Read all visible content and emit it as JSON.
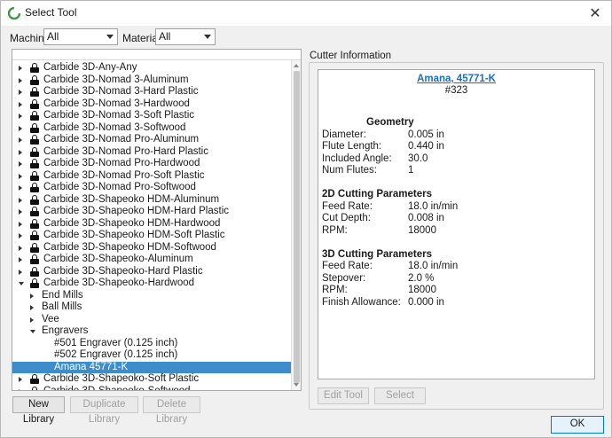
{
  "window": {
    "title": "Select Tool"
  },
  "filters": {
    "machine_label": "Machine",
    "machine_value": "All",
    "material_label": "Material",
    "material_value": "All"
  },
  "tree": [
    {
      "label": "Carbide 3D-Any-Any",
      "level": 0,
      "expander": "collapsed",
      "lock": true
    },
    {
      "label": "Carbide 3D-Nomad 3-Aluminum",
      "level": 0,
      "expander": "collapsed",
      "lock": true
    },
    {
      "label": "Carbide 3D-Nomad 3-Hard Plastic",
      "level": 0,
      "expander": "collapsed",
      "lock": true
    },
    {
      "label": "Carbide 3D-Nomad 3-Hardwood",
      "level": 0,
      "expander": "collapsed",
      "lock": true
    },
    {
      "label": "Carbide 3D-Nomad 3-Soft Plastic",
      "level": 0,
      "expander": "collapsed",
      "lock": true
    },
    {
      "label": "Carbide 3D-Nomad 3-Softwood",
      "level": 0,
      "expander": "collapsed",
      "lock": true
    },
    {
      "label": "Carbide 3D-Nomad Pro-Aluminum",
      "level": 0,
      "expander": "collapsed",
      "lock": true
    },
    {
      "label": "Carbide 3D-Nomad Pro-Hard Plastic",
      "level": 0,
      "expander": "collapsed",
      "lock": true
    },
    {
      "label": "Carbide 3D-Nomad Pro-Hardwood",
      "level": 0,
      "expander": "collapsed",
      "lock": true
    },
    {
      "label": "Carbide 3D-Nomad Pro-Soft Plastic",
      "level": 0,
      "expander": "collapsed",
      "lock": true
    },
    {
      "label": "Carbide 3D-Nomad Pro-Softwood",
      "level": 0,
      "expander": "collapsed",
      "lock": true
    },
    {
      "label": "Carbide 3D-Shapeoko HDM-Aluminum",
      "level": 0,
      "expander": "collapsed",
      "lock": true
    },
    {
      "label": "Carbide 3D-Shapeoko HDM-Hard Plastic",
      "level": 0,
      "expander": "collapsed",
      "lock": true
    },
    {
      "label": "Carbide 3D-Shapeoko HDM-Hardwood",
      "level": 0,
      "expander": "collapsed",
      "lock": true
    },
    {
      "label": "Carbide 3D-Shapeoko HDM-Soft Plastic",
      "level": 0,
      "expander": "collapsed",
      "lock": true
    },
    {
      "label": "Carbide 3D-Shapeoko HDM-Softwood",
      "level": 0,
      "expander": "collapsed",
      "lock": true
    },
    {
      "label": "Carbide 3D-Shapeoko-Aluminum",
      "level": 0,
      "expander": "collapsed",
      "lock": true
    },
    {
      "label": "Carbide 3D-Shapeoko-Hard Plastic",
      "level": 0,
      "expander": "collapsed",
      "lock": true
    },
    {
      "label": "Carbide 3D-Shapeoko-Hardwood",
      "level": 0,
      "expander": "expanded",
      "lock": true
    },
    {
      "label": "End Mills",
      "level": 1,
      "expander": "collapsed",
      "lock": false
    },
    {
      "label": "Ball Mills",
      "level": 1,
      "expander": "collapsed",
      "lock": false
    },
    {
      "label": "Vee",
      "level": 1,
      "expander": "collapsed",
      "lock": false
    },
    {
      "label": "Engravers",
      "level": 1,
      "expander": "expanded",
      "lock": false
    },
    {
      "label": "#501 Engraver (0.125 inch)",
      "level": 2,
      "expander": "none",
      "lock": false
    },
    {
      "label": "#502 Engraver (0.125 inch)",
      "level": 2,
      "expander": "none",
      "lock": false
    },
    {
      "label": "Amana 45771-K",
      "level": 2,
      "expander": "none",
      "lock": false,
      "selected": true
    },
    {
      "label": "Carbide 3D-Shapeoko-Soft Plastic",
      "level": 0,
      "expander": "collapsed",
      "lock": true
    },
    {
      "label": "Carbide 3D-Shapeoko-Softwood",
      "level": 0,
      "expander": "collapsed",
      "lock": true
    },
    {
      "label": "",
      "level": 0,
      "expander": "collapsed",
      "lock": true
    }
  ],
  "library_buttons": {
    "new": "New Library",
    "duplicate": "Duplicate Library",
    "delete": "Delete Library"
  },
  "cutter": {
    "group_label": "Cutter Information",
    "tool_name": "Amana, 45771-K",
    "tool_number": "#323",
    "geometry": {
      "title": "Geometry",
      "rows": [
        {
          "label": "Diameter:",
          "value": "0.005 in"
        },
        {
          "label": "Flute Length:",
          "value": "0.440 in"
        },
        {
          "label": "Included Angle:",
          "value": "30.0"
        },
        {
          "label": "Num Flutes:",
          "value": "1"
        }
      ]
    },
    "params_2d": {
      "title": "2D Cutting Parameters",
      "rows": [
        {
          "label": "Feed Rate:",
          "value": "18.0 in/min"
        },
        {
          "label": "Cut Depth:",
          "value": "0.008 in"
        },
        {
          "label": "RPM:",
          "value": "18000"
        }
      ]
    },
    "params_3d": {
      "title": "3D Cutting Parameters",
      "rows": [
        {
          "label": "Feed Rate:",
          "value": "18.0 in/min"
        },
        {
          "label": "Stepover:",
          "value": "2.0 %"
        },
        {
          "label": "RPM:",
          "value": "18000"
        },
        {
          "label": "Finish Allowance:",
          "value": "0.000 in"
        }
      ]
    },
    "edit_tool": "Edit Tool",
    "select": "Select"
  },
  "ok": "OK",
  "colors": {
    "selection": "#3d8ccc",
    "link": "#1a6fc4",
    "app_icon": "#3c9a3c"
  }
}
